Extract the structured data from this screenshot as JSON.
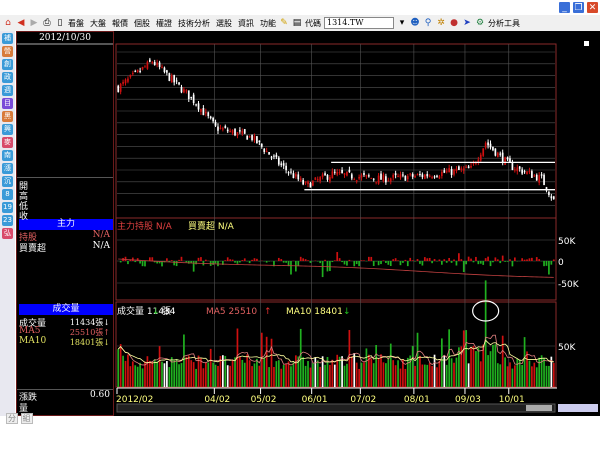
{
  "window": {
    "min": "_",
    "restore": "❐",
    "close": "✕"
  },
  "toolbar": {
    "menus": [
      "看盤",
      "大盤",
      "報價",
      "個股",
      "權證",
      "技術分析",
      "選股",
      "資訊",
      "功能"
    ],
    "code_label": "代碼",
    "code_value": "1314.TW",
    "analysis_tools": "分析工具"
  },
  "sidebar_icons": [
    "補",
    "營",
    "創",
    "政",
    "週",
    "目",
    "黑",
    "興",
    "麥",
    "南",
    "漲",
    "沉",
    "8",
    "19",
    "23",
    "弘"
  ],
  "left_panel": {
    "date": "2012/10/30",
    "ohlc": [
      "開",
      "高",
      "低",
      "收"
    ],
    "main_force": {
      "title": "主力",
      "rows": [
        {
          "label": "持股",
          "value": "N/A"
        },
        {
          "label": "買賣超",
          "value": "N/A"
        }
      ]
    },
    "volume": {
      "title": "成交量",
      "rows": [
        {
          "label": "成交量",
          "value": "11434張↓"
        },
        {
          "label": "MA5",
          "value": "25510張↑"
        },
        {
          "label": "MA10",
          "value": "18401張↓"
        }
      ]
    },
    "change": {
      "label": "漲跌",
      "value": "0.60",
      "label2": "量"
    }
  },
  "main_force_panel": {
    "legend1": "主力持股 N/A",
    "legend2": "買賣超 N/A",
    "axis": [
      "50K",
      "0",
      "-50K"
    ]
  },
  "volume_panel": {
    "legend_vol": "成交量 11434",
    "legend_vol_unit": "張",
    "legend_ma5": "MA5 25510",
    "legend_ma10": "MA10 18401",
    "legend_unit": "張",
    "axis": [
      "50K"
    ]
  },
  "dates": [
    {
      "label": "2012/02",
      "bar": 0
    },
    {
      "label": "04/02",
      "bar": 40
    },
    {
      "label": "05/02",
      "bar": 59
    },
    {
      "label": "06/01",
      "bar": 80
    },
    {
      "label": "07/02",
      "bar": 100
    },
    {
      "label": "08/01",
      "bar": 122
    },
    {
      "label": "09/03",
      "bar": 143
    },
    {
      "label": "10/01",
      "bar": 161
    }
  ],
  "bottom_tabs": [
    "分",
    "組"
  ],
  "chart_data": {
    "type": "candlestick",
    "bars": 180,
    "price_path": [
      [
        0,
        78
      ],
      [
        14,
        94
      ],
      [
        32,
        69
      ],
      [
        40,
        54
      ],
      [
        55,
        48
      ],
      [
        67,
        31
      ],
      [
        77,
        19
      ],
      [
        88,
        26
      ],
      [
        108,
        23
      ],
      [
        125,
        25
      ],
      [
        145,
        29
      ],
      [
        151,
        45
      ],
      [
        161,
        31
      ],
      [
        174,
        23
      ],
      [
        179,
        10
      ]
    ],
    "support_lines": [
      {
        "from_bar": 77,
        "value": 16.5
      },
      {
        "from_bar": 88,
        "value": 33
      }
    ],
    "volume_peak_bar": 151,
    "volume_peak": 100000
  },
  "colors": {
    "up": "#d01010",
    "down": "#20b020",
    "grid": "#555",
    "border": "#8a2a2a"
  }
}
